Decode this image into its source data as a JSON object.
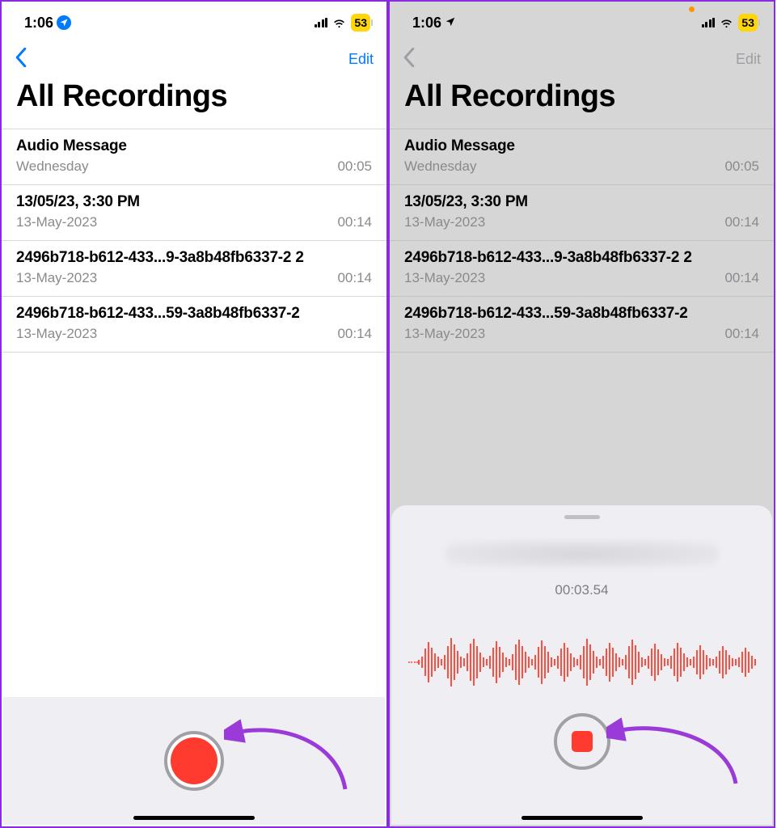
{
  "status": {
    "time": "1:06",
    "battery": "53"
  },
  "nav": {
    "edit": "Edit"
  },
  "page": {
    "title": "All Recordings"
  },
  "recordings": [
    {
      "title": "Audio Message",
      "subtitle": "Wednesday",
      "duration": "00:05"
    },
    {
      "title": "13/05/23, 3:30 PM",
      "subtitle": "13-May-2023",
      "duration": "00:14"
    },
    {
      "title": "2496b718-b612-433...9-3a8b48fb6337-2 2",
      "subtitle": "13-May-2023",
      "duration": "00:14"
    },
    {
      "title": "2496b718-b612-433...59-3a8b48fb6337-2",
      "subtitle": "13-May-2023",
      "duration": "00:14"
    }
  ],
  "sheet": {
    "elapsed": "00:03.54"
  }
}
